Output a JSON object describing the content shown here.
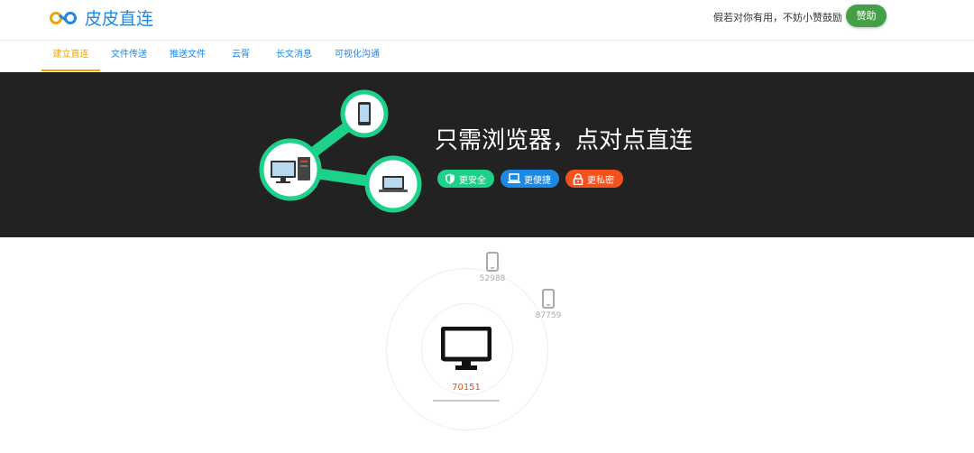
{
  "header": {
    "logo_text": "皮皮直连",
    "support_text": "假若对你有用，不妨小赞鼓励",
    "support_button": "赞助"
  },
  "nav": {
    "tabs": [
      {
        "label": "建立直连",
        "active": true
      },
      {
        "label": "文件传送",
        "active": false
      },
      {
        "label": "推送文件",
        "active": false
      },
      {
        "label": "云胥",
        "active": false
      },
      {
        "label": "长文消息",
        "active": false
      },
      {
        "label": "可视化沟通",
        "active": false
      }
    ]
  },
  "hero": {
    "title": "只需浏览器，点对点直连",
    "badges": [
      {
        "label": "更安全",
        "icon": "shield-icon",
        "color": "#1ed18a"
      },
      {
        "label": "更便捷",
        "icon": "laptop-icon",
        "color": "#1e88e5"
      },
      {
        "label": "更私密",
        "icon": "lock-icon",
        "color": "#f4511e"
      }
    ]
  },
  "radar": {
    "peers": [
      {
        "id": "52988",
        "icon": "phone-icon"
      },
      {
        "id": "87759",
        "icon": "phone-icon"
      }
    ],
    "self": {
      "id": "70151",
      "icon": "monitor-icon"
    }
  },
  "colors": {
    "brand": "#1e88e5",
    "active_tab": "#f0a500",
    "hero_bg": "#222222",
    "accent_green": "#1ed18a",
    "self_id": "#e8540c"
  }
}
